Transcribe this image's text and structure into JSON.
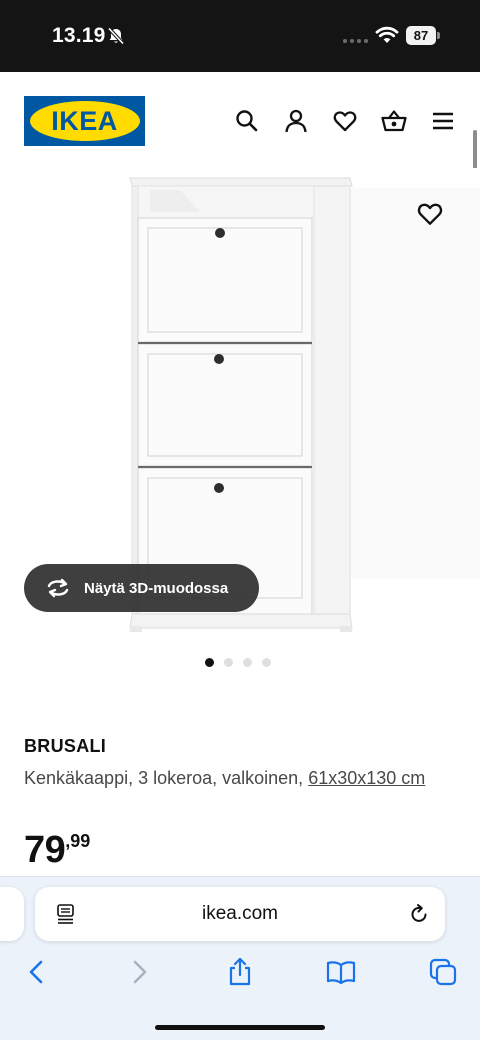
{
  "status_bar": {
    "time": "13.19",
    "battery": "87",
    "icons": [
      "bell-off-icon",
      "signal-icon",
      "wifi-icon",
      "battery-icon"
    ]
  },
  "header": {
    "logo_text": "IKEA",
    "icons": [
      "search-icon",
      "user-icon",
      "heart-icon",
      "cart-icon",
      "menu-icon"
    ]
  },
  "gallery": {
    "view_3d_label": "Näytä 3D-muodossa",
    "slide_count": 4,
    "active_slide": 1
  },
  "product": {
    "name": "BRUSALI",
    "description": "Kenkäkaappi, 3 lokeroa, valkoinen,",
    "dimensions": "61x30x130 cm",
    "price_integer": "79",
    "price_decimal": ",99"
  },
  "browser": {
    "url": "ikea.com",
    "toolbar_icons": [
      "back-icon",
      "forward-icon",
      "share-icon",
      "bookmarks-icon",
      "tabs-icon"
    ]
  },
  "colors": {
    "ikea_blue": "#0058a3",
    "ikea_yellow": "#ffdb00",
    "safari_accent": "#1a73e8"
  }
}
